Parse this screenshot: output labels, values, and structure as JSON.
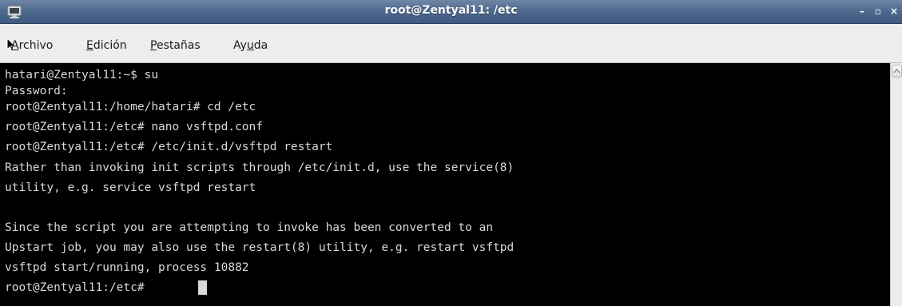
{
  "window": {
    "title": "root@Zentyal11: /etc",
    "minimize_glyph": "–",
    "maximize_glyph": "▫",
    "close_glyph": "×"
  },
  "menubar": {
    "items": [
      {
        "mnemonic": "A",
        "rest": "rchivo"
      },
      {
        "mnemonic": "E",
        "rest": "dición"
      },
      {
        "mnemonic": "P",
        "rest": "estañas"
      },
      {
        "prefix": "Ay",
        "mnemonic": "u",
        "rest": "da"
      }
    ]
  },
  "terminal": {
    "lines": [
      "hatari@Zentyal11:~$ su",
      "Password:",
      "root@Zentyal11:/home/hatari# cd /etc",
      "root@Zentyal11:/etc# nano vsftpd.conf",
      "root@Zentyal11:/etc# /etc/init.d/vsftpd restart",
      "Rather than invoking init scripts through /etc/init.d, use the service(8)",
      "utility, e.g. service vsftpd restart",
      "",
      "Since the script you are attempting to invoke has been converted to an",
      "Upstart job, you may also use the restart(8) utility, e.g. restart vsftpd",
      "vsftpd start/running, process 10882",
      "root@Zentyal11:/etc# "
    ]
  },
  "colors": {
    "titlebar": "#4f6a8e",
    "menubar": "#ededed",
    "terminal_bg": "#000000",
    "terminal_fg": "#d9d9d9"
  },
  "icons": {
    "title_icon": "terminal-icon",
    "pointer": "mouse-pointer-icon"
  }
}
